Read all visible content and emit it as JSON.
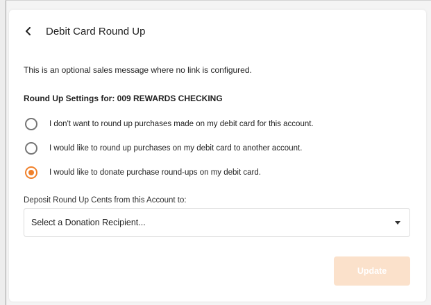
{
  "header": {
    "title": "Debit Card Round Up",
    "back_icon": "chevron-left-icon"
  },
  "sales_message": "This is an optional sales message where no link is configured.",
  "settings": {
    "label": "Round Up Settings for: 009 REWARDS CHECKING",
    "options": [
      {
        "label": "I don't want to round up purchases made on my debit card for this account.",
        "selected": false
      },
      {
        "label": "I would like to round up purchases on my debit card to another account.",
        "selected": false
      },
      {
        "label": "I would like to donate purchase round-ups on my debit card.",
        "selected": true
      }
    ]
  },
  "deposit": {
    "label": "Deposit Round Up Cents from this Account to:",
    "select_value": "Select a Donation Recipient..."
  },
  "actions": {
    "update_label": "Update",
    "update_disabled": true
  },
  "colors": {
    "accent": "#f0802a",
    "button_disabled_bg": "#fbe1cb",
    "radio_unselected": "#757575"
  }
}
